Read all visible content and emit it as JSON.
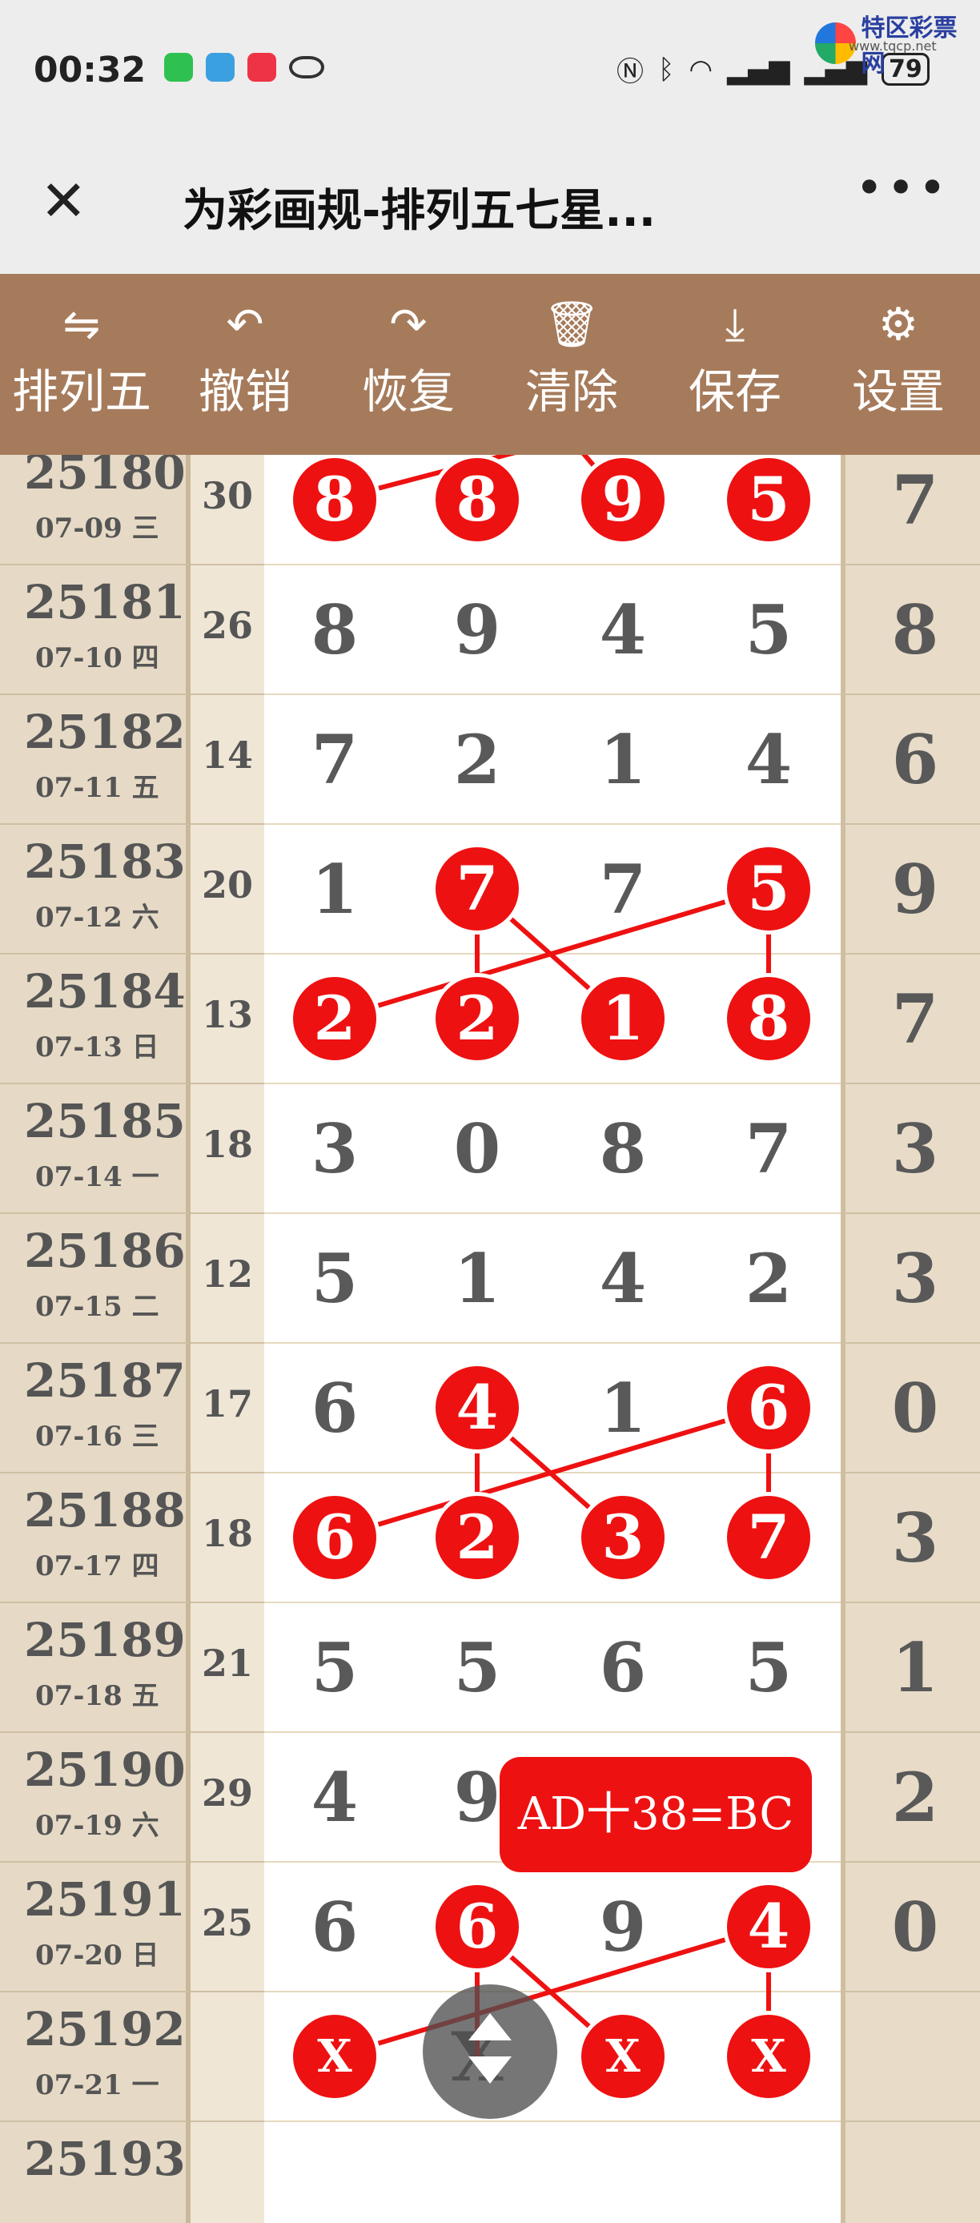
{
  "status": {
    "time": "00:32",
    "battery": "79",
    "watermark": "特区彩票网",
    "watermark_url": "www.tqcp.net"
  },
  "header": {
    "title": "为彩画规-排列五七星..."
  },
  "toolbar": [
    {
      "icon": "swap-icon",
      "label": "排列五"
    },
    {
      "icon": "undo-icon",
      "label": "撤销"
    },
    {
      "icon": "redo-icon",
      "label": "恢复"
    },
    {
      "icon": "trash-icon",
      "label": "清除"
    },
    {
      "icon": "download-icon",
      "label": "保存"
    },
    {
      "icon": "gear-icon",
      "label": "设置"
    }
  ],
  "rows": [
    {
      "issue": "25180",
      "date": "07-09 三",
      "sum": "30",
      "d": [
        "8",
        "8",
        "9",
        "5"
      ],
      "tail": "7",
      "mark": [
        true,
        true,
        true,
        true
      ]
    },
    {
      "issue": "25181",
      "date": "07-10 四",
      "sum": "26",
      "d": [
        "8",
        "9",
        "4",
        "5"
      ],
      "tail": "8",
      "mark": [
        false,
        false,
        false,
        false
      ]
    },
    {
      "issue": "25182",
      "date": "07-11 五",
      "sum": "14",
      "d": [
        "7",
        "2",
        "1",
        "4"
      ],
      "tail": "6",
      "mark": [
        false,
        false,
        false,
        false
      ]
    },
    {
      "issue": "25183",
      "date": "07-12 六",
      "sum": "20",
      "d": [
        "1",
        "7",
        "7",
        "5"
      ],
      "tail": "9",
      "mark": [
        false,
        true,
        false,
        true
      ]
    },
    {
      "issue": "25184",
      "date": "07-13 日",
      "sum": "13",
      "d": [
        "2",
        "2",
        "1",
        "8"
      ],
      "tail": "7",
      "mark": [
        true,
        true,
        true,
        true
      ]
    },
    {
      "issue": "25185",
      "date": "07-14 一",
      "sum": "18",
      "d": [
        "3",
        "0",
        "8",
        "7"
      ],
      "tail": "3",
      "mark": [
        false,
        false,
        false,
        false
      ]
    },
    {
      "issue": "25186",
      "date": "07-15 二",
      "sum": "12",
      "d": [
        "5",
        "1",
        "4",
        "2"
      ],
      "tail": "3",
      "mark": [
        false,
        false,
        false,
        false
      ]
    },
    {
      "issue": "25187",
      "date": "07-16 三",
      "sum": "17",
      "d": [
        "6",
        "4",
        "1",
        "6"
      ],
      "tail": "0",
      "mark": [
        false,
        true,
        false,
        true
      ]
    },
    {
      "issue": "25188",
      "date": "07-17 四",
      "sum": "18",
      "d": [
        "6",
        "2",
        "3",
        "7"
      ],
      "tail": "3",
      "mark": [
        true,
        true,
        true,
        true
      ]
    },
    {
      "issue": "25189",
      "date": "07-18 五",
      "sum": "21",
      "d": [
        "5",
        "5",
        "6",
        "5"
      ],
      "tail": "1",
      "mark": [
        false,
        false,
        false,
        false
      ]
    },
    {
      "issue": "25190",
      "date": "07-19 六",
      "sum": "29",
      "d": [
        "4",
        "9",
        "",
        ""
      ],
      "tail": "2",
      "mark": [
        false,
        false,
        false,
        false
      ]
    },
    {
      "issue": "25191",
      "date": "07-20 日",
      "sum": "25",
      "d": [
        "6",
        "6",
        "9",
        "4"
      ],
      "tail": "0",
      "mark": [
        false,
        true,
        false,
        true
      ]
    },
    {
      "issue": "25192",
      "date": "07-21 一",
      "sum": "",
      "d": [
        "X",
        "X",
        "X",
        "X"
      ],
      "tail": "",
      "mark": [
        true,
        false,
        true,
        true
      ]
    },
    {
      "issue": "25193",
      "date": "",
      "sum": "",
      "d": [
        "",
        "",
        "",
        ""
      ],
      "tail": "",
      "mark": [
        false,
        false,
        false,
        false
      ]
    }
  ],
  "formula": "AD十38=BC",
  "colors": {
    "toolbar": "#a67b5b",
    "ball": "#ee1111",
    "header_bg": "#ededed"
  }
}
